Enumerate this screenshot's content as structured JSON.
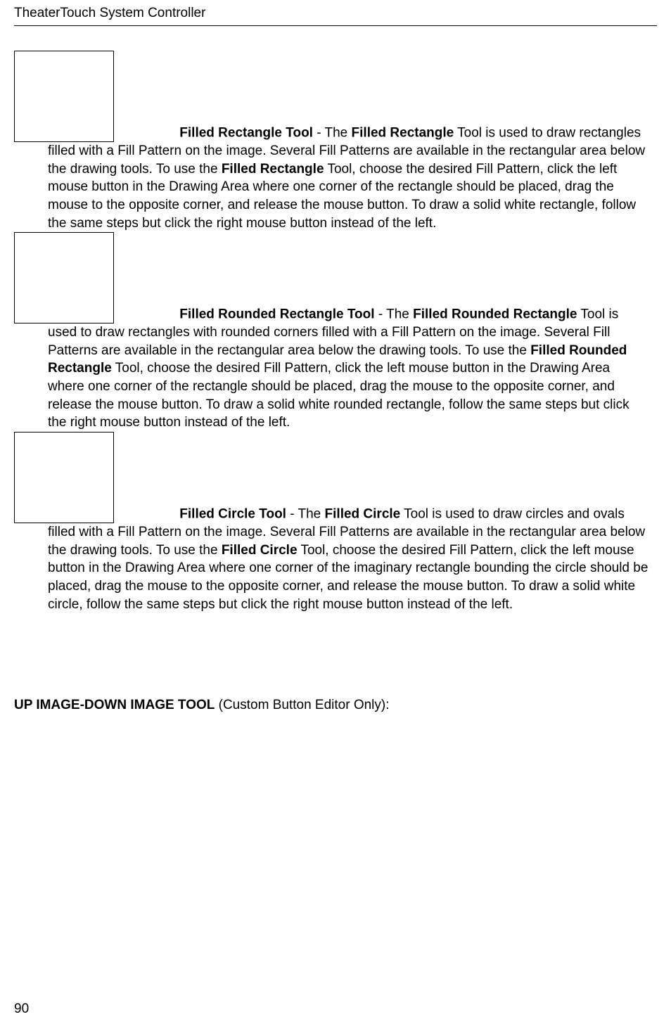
{
  "header": {
    "title": "TheaterTouch System Controller"
  },
  "sections": [
    {
      "tool_name": "Filled Rectangle Tool",
      "dash": " - ",
      "t1": "The ",
      "b1": "Filled Rectangle",
      "t2": " Tool is used to draw rectangles filled with a Fill Pattern on the image. Several Fill Patterns are available in the rectangular area below the drawing tools.  To use the ",
      "b2": "Filled Rectangle",
      "t3": " Tool, choose the desired Fill Pattern, click the left mouse button in the Drawing Area where one corner of the rectangle should be placed, drag the mouse to the opposite corner, and release the mouse button.  To draw a solid white rectangle, follow the same steps but click the right mouse button instead of the left."
    },
    {
      "tool_name": "Filled Rounded Rectangle Tool",
      "dash": " - ",
      "t1": "The ",
      "b1": "Filled Rounded Rectangle",
      "t2": " Tool is used to draw rectangles with rounded corners filled with a Fill Pattern on the image. Several Fill Patterns are available in the rectangular area below the drawing tools.  To use the ",
      "b2": "Filled Rounded Rectangle",
      "t3": " Tool, choose the desired Fill Pattern, click the left mouse button in the Drawing Area where one corner of the rectangle should be placed, drag the mouse to the opposite corner, and release the mouse button.  To draw a solid white rounded rectangle, follow the same steps but click the right mouse button instead of the left."
    },
    {
      "tool_name": "Filled Circle Tool",
      "dash": " - ",
      "t1": "The ",
      "b1": "Filled Circle",
      "t2": " Tool is used to draw circles and ovals filled with a Fill Pattern on the image. Several Fill Patterns are available in the rectangular area below the drawing tools.  To use the ",
      "b2": "Filled Circle",
      "t3": " Tool, choose the desired Fill Pattern, click the left mouse button in the Drawing Area where one corner of the imaginary rectangle bounding the circle should be placed, drag the mouse to the opposite corner, and release the mouse button.  To draw a solid white circle, follow the same steps but click the right mouse button instead of the left."
    }
  ],
  "sub_heading": {
    "bold": "UP IMAGE-DOWN IMAGE TOOL",
    "rest": " (Custom Button Editor Only):"
  },
  "page_number": "90"
}
